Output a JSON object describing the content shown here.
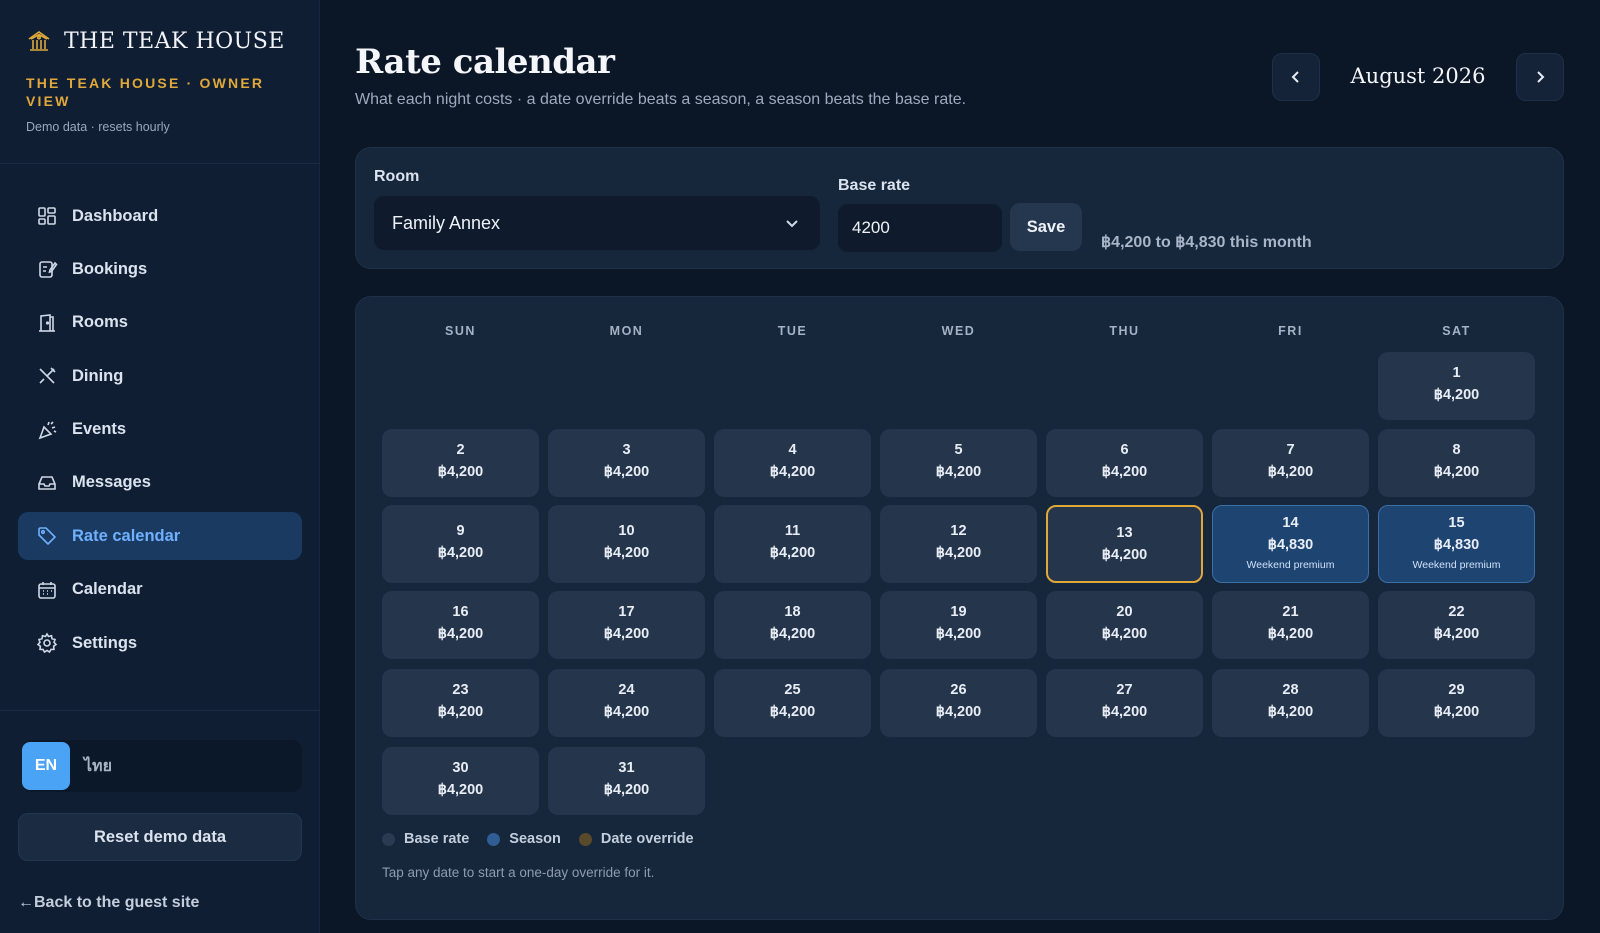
{
  "brand": {
    "name": "THE TEAK HOUSE",
    "owner_view": "THE TEAK HOUSE · OWNER VIEW",
    "demo_note": "Demo data · resets hourly"
  },
  "nav": [
    {
      "label": "Dashboard",
      "icon": "dashboard-icon"
    },
    {
      "label": "Bookings",
      "icon": "bookings-icon"
    },
    {
      "label": "Rooms",
      "icon": "rooms-icon"
    },
    {
      "label": "Dining",
      "icon": "dining-icon"
    },
    {
      "label": "Events",
      "icon": "events-icon"
    },
    {
      "label": "Messages",
      "icon": "messages-icon"
    },
    {
      "label": "Rate calendar",
      "icon": "tag-icon",
      "active": true
    },
    {
      "label": "Calendar",
      "icon": "calendar-icon"
    },
    {
      "label": "Settings",
      "icon": "gear-icon"
    }
  ],
  "language": {
    "active": "EN",
    "other": "ไทย"
  },
  "reset_label": "Reset demo data",
  "back_label": "←Back to the guest site",
  "page": {
    "title": "Rate calendar",
    "subtitle": "What each night costs · a date override beats a season, a season beats the base rate.",
    "month": "August 2026"
  },
  "controls": {
    "room_label": "Room",
    "room_value": "Family Annex",
    "base_label": "Base rate",
    "base_value": "4200",
    "save_label": "Save",
    "range_text": "฿4,200 to ฿4,830 this month"
  },
  "calendar": {
    "weekdays": [
      "SUN",
      "MON",
      "TUE",
      "WED",
      "THU",
      "FRI",
      "SAT"
    ],
    "days": [
      {
        "day": "1",
        "price": "฿4,200"
      },
      {
        "day": "2",
        "price": "฿4,200"
      },
      {
        "day": "3",
        "price": "฿4,200"
      },
      {
        "day": "4",
        "price": "฿4,200"
      },
      {
        "day": "5",
        "price": "฿4,200"
      },
      {
        "day": "6",
        "price": "฿4,200"
      },
      {
        "day": "7",
        "price": "฿4,200"
      },
      {
        "day": "8",
        "price": "฿4,200"
      },
      {
        "day": "9",
        "price": "฿4,200"
      },
      {
        "day": "10",
        "price": "฿4,200"
      },
      {
        "day": "11",
        "price": "฿4,200"
      },
      {
        "day": "12",
        "price": "฿4,200"
      },
      {
        "day": "13",
        "price": "฿4,200",
        "today": true
      },
      {
        "day": "14",
        "price": "฿4,830",
        "season": "Weekend premium"
      },
      {
        "day": "15",
        "price": "฿4,830",
        "season": "Weekend premium"
      },
      {
        "day": "16",
        "price": "฿4,200"
      },
      {
        "day": "17",
        "price": "฿4,200"
      },
      {
        "day": "18",
        "price": "฿4,200"
      },
      {
        "day": "19",
        "price": "฿4,200"
      },
      {
        "day": "20",
        "price": "฿4,200"
      },
      {
        "day": "21",
        "price": "฿4,200"
      },
      {
        "day": "22",
        "price": "฿4,200"
      },
      {
        "day": "23",
        "price": "฿4,200"
      },
      {
        "day": "24",
        "price": "฿4,200"
      },
      {
        "day": "25",
        "price": "฿4,200"
      },
      {
        "day": "26",
        "price": "฿4,200"
      },
      {
        "day": "27",
        "price": "฿4,200"
      },
      {
        "day": "28",
        "price": "฿4,200"
      },
      {
        "day": "29",
        "price": "฿4,200"
      },
      {
        "day": "30",
        "price": "฿4,200"
      },
      {
        "day": "31",
        "price": "฿4,200"
      }
    ],
    "legend": [
      {
        "label": "Base rate",
        "color": "#2a3a50"
      },
      {
        "label": "Season",
        "color": "#2f5d94"
      },
      {
        "label": "Date override",
        "color": "#5a4a2c"
      }
    ],
    "hint": "Tap any date to start a one-day override for it."
  },
  "colors": {
    "accent": "#6fb0ff",
    "gold": "#e0a83a",
    "season": "#1e4472"
  }
}
